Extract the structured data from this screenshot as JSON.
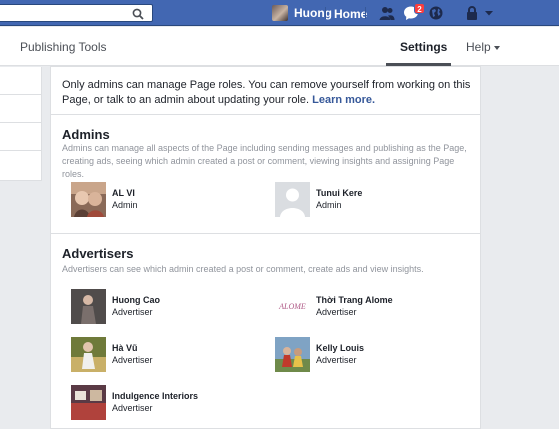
{
  "topbar": {
    "profile_name": "Huong",
    "home_label": "Home",
    "notification_count": "2"
  },
  "tabs": {
    "publishing_tools": "Publishing Tools",
    "settings": "Settings",
    "help": "Help"
  },
  "notice": {
    "text": "Only admins can manage Page roles. You can remove yourself from working on this Page, or talk to an admin about updating your role.",
    "link": "Learn more."
  },
  "admins": {
    "title": "Admins",
    "description": "Admins can manage all aspects of the Page including sending messages and publishing as the Page, creating ads, seeing which admin created a post or comment, viewing insights and assigning Page roles.",
    "people": [
      {
        "name": "AL VI",
        "role": "Admin"
      },
      {
        "name": "Tunui Kere",
        "role": "Admin"
      }
    ]
  },
  "advertisers": {
    "title": "Advertisers",
    "description": "Advertisers can see which admin created a post or comment, create ads and view insights.",
    "people": [
      {
        "name": "Huong Cao",
        "role": "Advertiser"
      },
      {
        "name": "Thời Trang Alome",
        "role": "Advertiser",
        "logo_text": "ALOME"
      },
      {
        "name": "Hà Vũ",
        "role": "Advertiser"
      },
      {
        "name": "Kelly Louis",
        "role": "Advertiser"
      },
      {
        "name": "Indulgence Interiors",
        "role": "Advertiser"
      }
    ]
  },
  "colors": {
    "brand_blue": "#4267b2",
    "link_blue": "#365899",
    "badge_red": "#fa3e3e",
    "page_bg": "#e9ebee"
  }
}
